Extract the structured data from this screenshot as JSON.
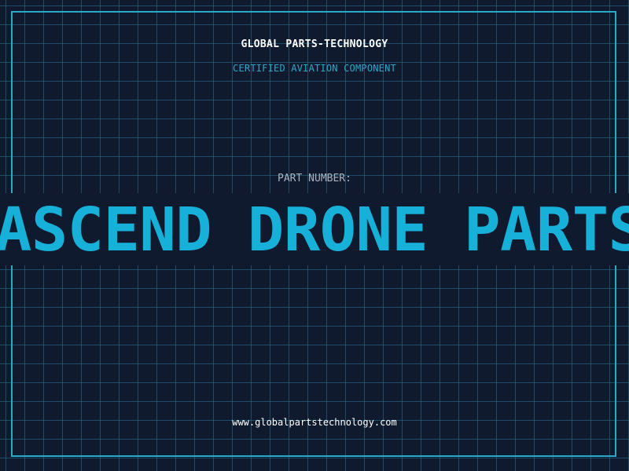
{
  "label": {
    "brand_name": "GLOBAL PARTS-TECHNOLOGY",
    "tagline": "CERTIFIED AVIATION COMPONENT",
    "part_number_label": "PART NUMBER:",
    "part_number_value": "ASCEND DRONE PARTS",
    "website": "www.globalpartstechnology.com"
  },
  "colors": {
    "background": "#101a2e",
    "grid": "#1e7896",
    "border": "#2aa9c9",
    "accent": "#16b0d8",
    "text_primary": "#ffffff",
    "text_muted": "#aab3bf"
  }
}
